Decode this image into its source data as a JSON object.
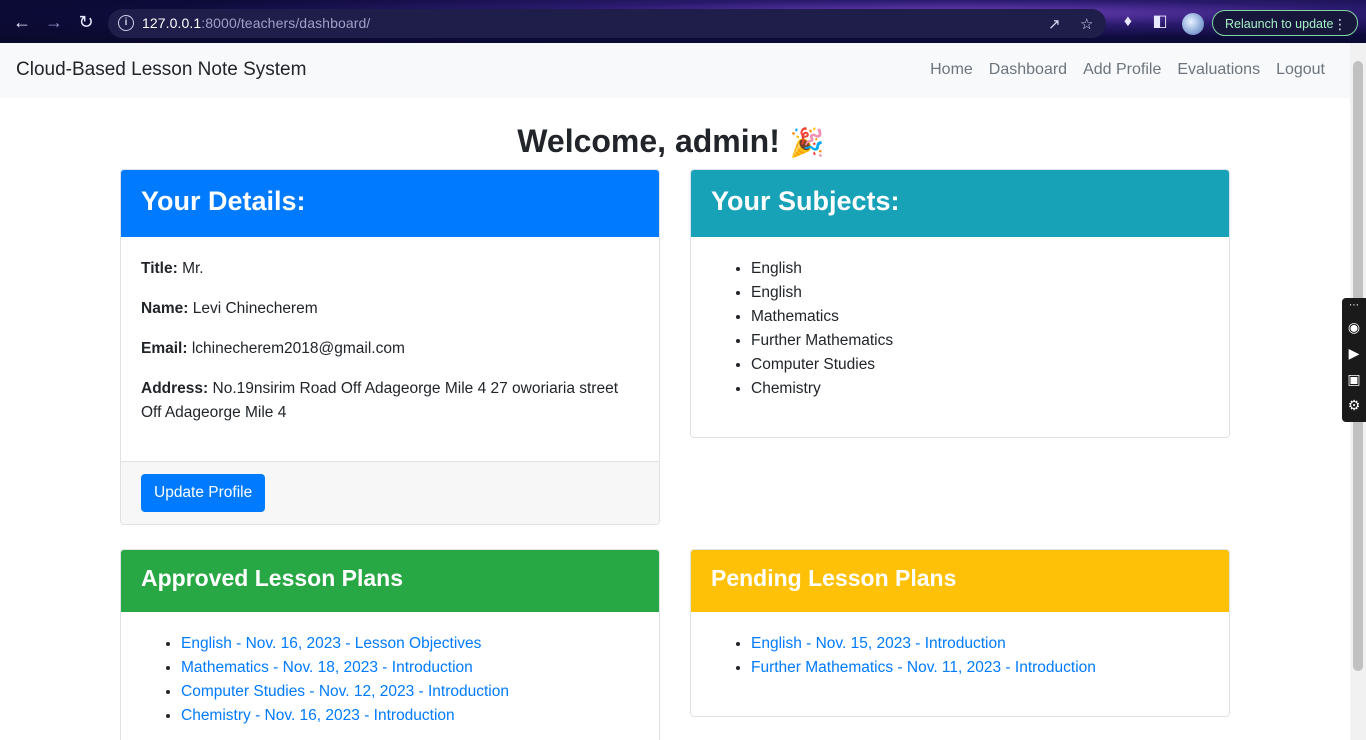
{
  "browser": {
    "url_host": "127.0.0.1",
    "url_path": ":8000/teachers/dashboard/",
    "relaunch_label": "Relaunch to update",
    "icons": [
      "back-icon",
      "forward-icon",
      "reload-icon",
      "info-icon",
      "share-icon",
      "star-icon",
      "extensions-icon",
      "sidepanel-icon",
      "profile-avatar",
      "menu-dots-icon"
    ]
  },
  "navbar": {
    "brand": "Cloud-Based Lesson Note System",
    "links": [
      "Home",
      "Dashboard",
      "Add Profile",
      "Evaluations",
      "Logout"
    ]
  },
  "welcome": {
    "text": "Welcome, admin!",
    "emoji": "🎉"
  },
  "details_card": {
    "title": "Your Details:",
    "header_color": "#007bff",
    "fields": [
      {
        "label": "Title:",
        "value": "Mr."
      },
      {
        "label": "Name:",
        "value": "Levi Chinecherem"
      },
      {
        "label": "Email:",
        "value": "lchinecherem2018@gmail.com"
      },
      {
        "label": "Address:",
        "value": "No.19nsirim Road Off Adageorge Mile 4 27 oworiaria street Off Adageorge Mile 4"
      }
    ],
    "button": "Update Profile"
  },
  "subjects_card": {
    "title": "Your Subjects:",
    "header_color": "#17a2b8",
    "items": [
      "English",
      "English",
      "Mathematics",
      "Further Mathematics",
      "Computer Studies",
      "Chemistry"
    ]
  },
  "approved_card": {
    "title": "Approved Lesson Plans",
    "header_color": "#28a745",
    "items": [
      "English - Nov. 16, 2023 - Lesson Objectives",
      "Mathematics - Nov. 18, 2023 - Introduction",
      "Computer Studies - Nov. 12, 2023 - Introduction",
      "Chemistry - Nov. 16, 2023 - Introduction"
    ]
  },
  "pending_card": {
    "title": "Pending Lesson Plans",
    "header_color": "#ffc107",
    "items": [
      "English - Nov. 15, 2023 - Introduction",
      "Further Mathematics - Nov. 11, 2023 - Introduction"
    ]
  }
}
